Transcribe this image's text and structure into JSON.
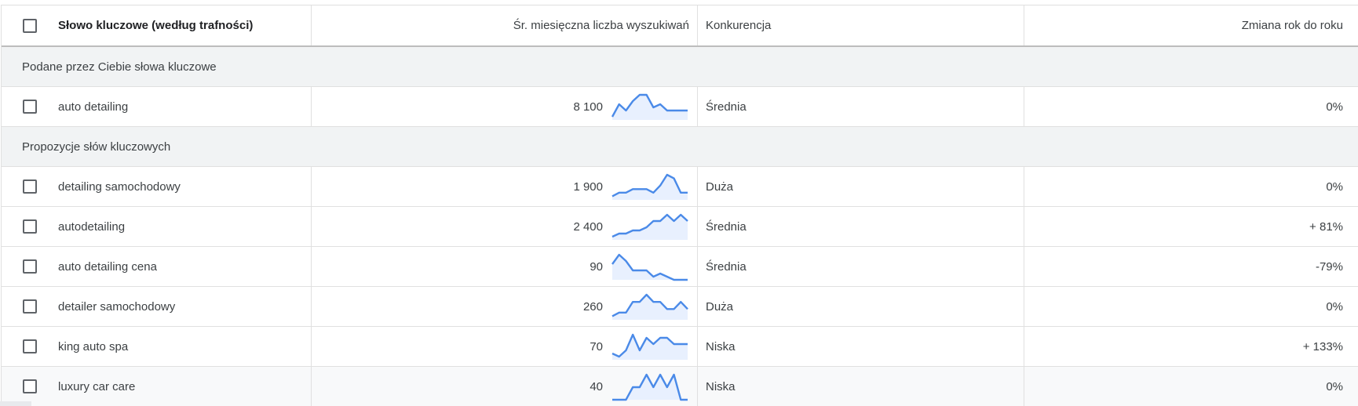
{
  "header": {
    "keyword": "Słowo kluczowe (według trafności)",
    "volume": "Śr. miesięczna liczba wyszukiwań",
    "competition": "Konkurencja",
    "yoy": "Zmiana rok do roku"
  },
  "groups": {
    "provided": "Podane przez Ciebie słowa kluczowe",
    "ideas": "Propozycje słów kluczowych"
  },
  "accent_color": "#4a8ae8",
  "rows": [
    {
      "keyword": "auto detailing",
      "volume": "8 100",
      "competition": "Średnia",
      "yoy": "0%",
      "trend": [
        1,
        5,
        3,
        6,
        8,
        8,
        4,
        5,
        3,
        3,
        3,
        3
      ]
    },
    {
      "keyword": "detailing samochodowy",
      "volume": "1 900",
      "competition": "Duża",
      "yoy": "0%",
      "trend": [
        1,
        2,
        2,
        3,
        3,
        3,
        2,
        4,
        7,
        6,
        2,
        2
      ]
    },
    {
      "keyword": "autodetailing",
      "volume": "2 400",
      "competition": "Średnia",
      "yoy": "+ 81%",
      "trend": [
        1,
        2,
        2,
        3,
        3,
        4,
        6,
        6,
        8,
        6,
        8,
        6
      ]
    },
    {
      "keyword": "auto detailing cena",
      "volume": "90",
      "competition": "Średnia",
      "yoy": "-79%",
      "trend": [
        5,
        8,
        6,
        3,
        3,
        3,
        1,
        2,
        1,
        0,
        0,
        0
      ]
    },
    {
      "keyword": "detailer samochodowy",
      "volume": "260",
      "competition": "Duża",
      "yoy": "0%",
      "trend": [
        1,
        2,
        2,
        5,
        5,
        7,
        5,
        5,
        3,
        3,
        5,
        3
      ]
    },
    {
      "keyword": "king auto spa",
      "volume": "70",
      "competition": "Niska",
      "yoy": "+ 133%",
      "trend": [
        2,
        1,
        3,
        8,
        3,
        7,
        5,
        7,
        7,
        5,
        5,
        5
      ]
    },
    {
      "keyword": "luxury car care",
      "volume": "40",
      "competition": "Niska",
      "yoy": "0%",
      "trend": [
        0,
        0,
        0,
        3,
        3,
        6,
        3,
        6,
        3,
        6,
        0,
        0
      ]
    }
  ]
}
